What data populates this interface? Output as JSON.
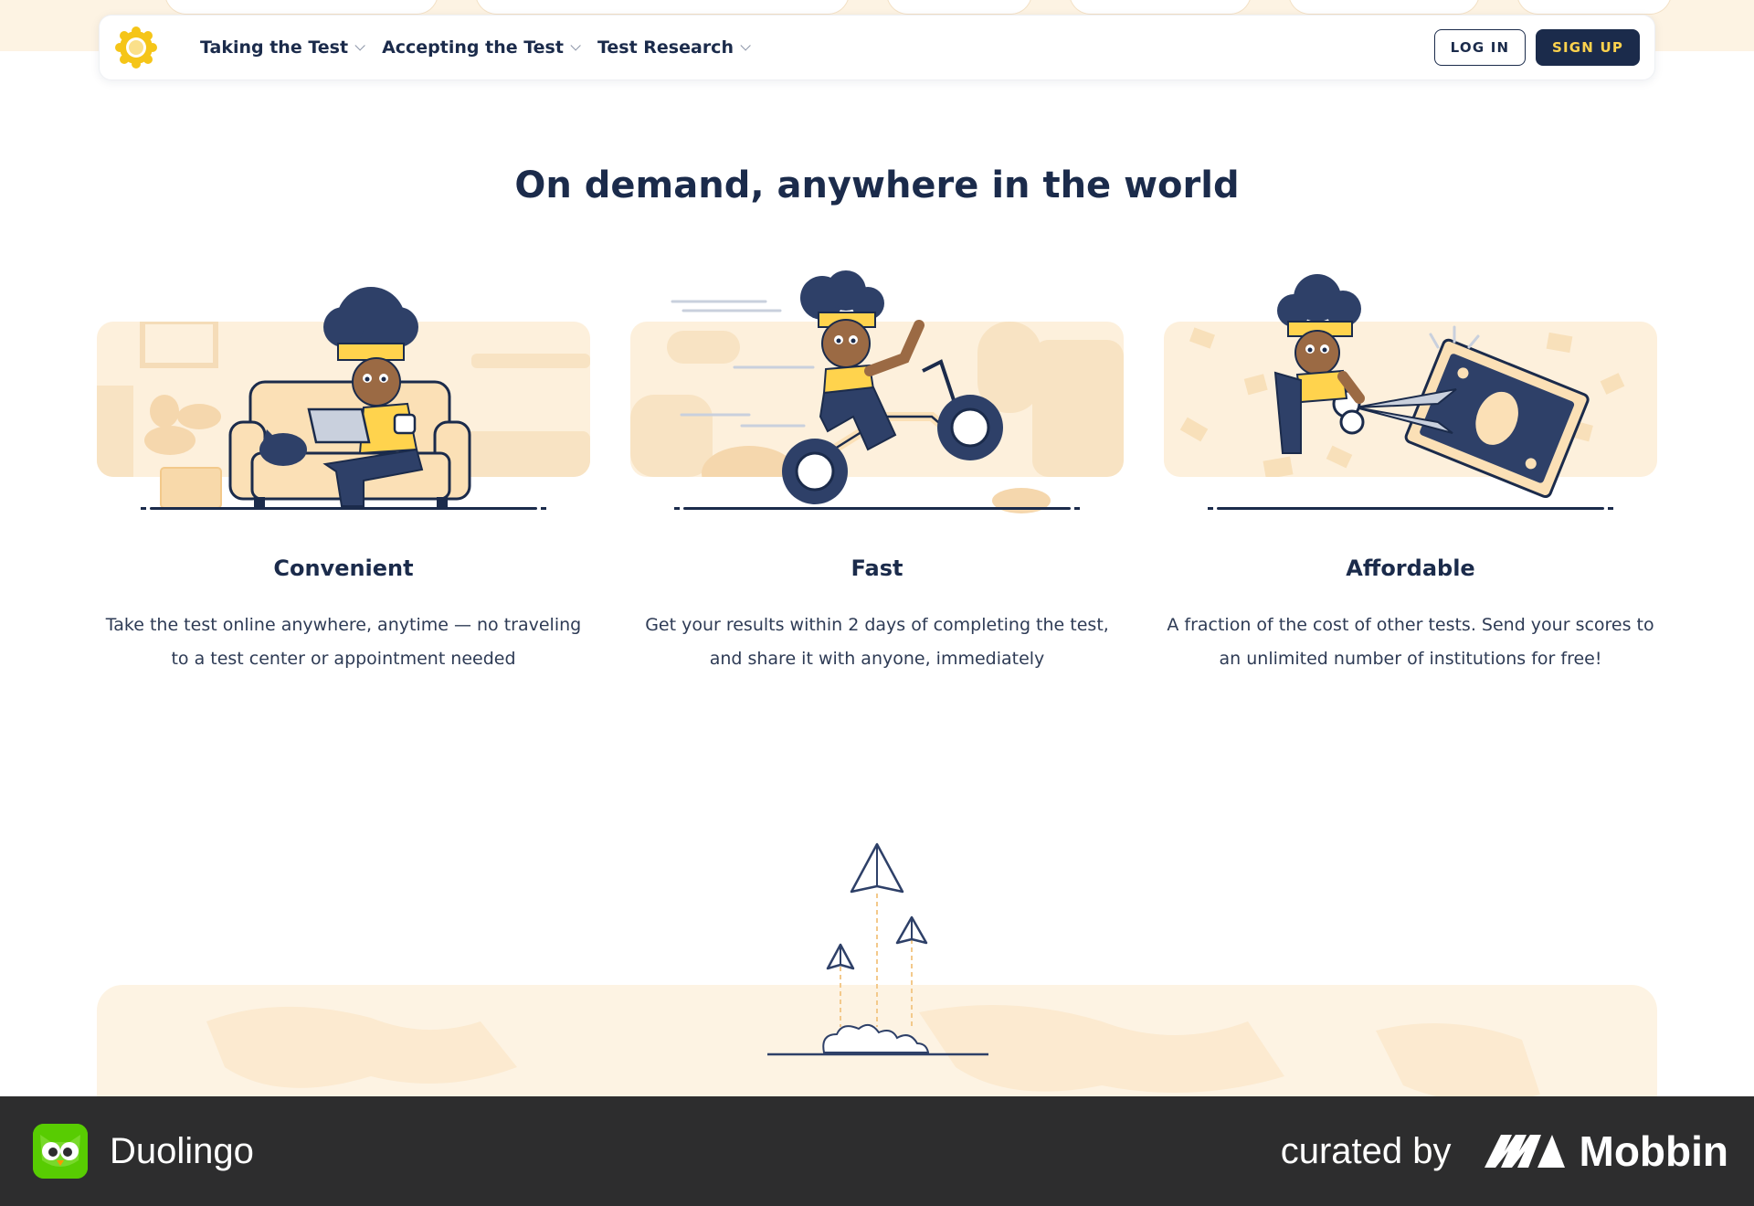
{
  "nav": {
    "logo_icon": "duolingo-english-test-sun-logo",
    "links": [
      {
        "label": "Taking the Test"
      },
      {
        "label": "Accepting the Test"
      },
      {
        "label": "Test Research"
      }
    ],
    "login_label": "LOG IN",
    "signup_label": "SIGN UP"
  },
  "headline": "On demand, anywhere in the world",
  "features": [
    {
      "title": "Convenient",
      "description": "Take the test online anywhere, anytime — no traveling to a test center or appointment needed",
      "illustration": "person-on-couch-with-laptop"
    },
    {
      "title": "Fast",
      "description": "Get your results within 2 days of completing the test, and share it with anyone, immediately",
      "illustration": "person-riding-bicycle"
    },
    {
      "title": "Affordable",
      "description": "A fraction of the cost of other tests. Send your scores to an unlimited number of institutions for free!",
      "illustration": "person-cutting-dollar-bill"
    }
  ],
  "footer": {
    "app_name": "Duolingo",
    "curated_by": "curated by",
    "brand": "Mobbin"
  },
  "colors": {
    "navy": "#1b2b4b",
    "cream": "#fdf0dc",
    "yellow": "#ffd34d",
    "footer_bg": "#2d2d2e",
    "duolingo_green": "#58cc02"
  }
}
